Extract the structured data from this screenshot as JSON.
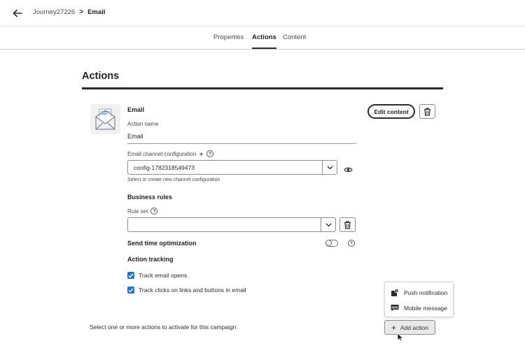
{
  "breadcrumb": {
    "parent": "Journey27226",
    "separator": ">",
    "current": "Email"
  },
  "tabs": [
    {
      "label": "Properties",
      "active": false
    },
    {
      "label": "Actions",
      "active": true
    },
    {
      "label": "Content",
      "active": false
    }
  ],
  "section": {
    "title": "Actions"
  },
  "action": {
    "heading": "Email",
    "thumb_icon": "envelope-icon",
    "edit_content_label": "Edit content",
    "action_name_label": "Action name",
    "action_name_value": "Email",
    "channel_config_label": "Email channel configuration",
    "required_mark": "∗",
    "channel_config_value": "config-1782318549473",
    "channel_config_help": "Select or create new channel configuration"
  },
  "business_rules": {
    "heading": "Business rules",
    "rule_set_label": "Rule set",
    "rule_set_value": ""
  },
  "send_time": {
    "label": "Send time optimization",
    "enabled": false
  },
  "tracking": {
    "heading": "Action tracking",
    "items": [
      {
        "label": "Track email opens",
        "checked": true
      },
      {
        "label": "Track clicks on links and buttons in email",
        "checked": true
      }
    ]
  },
  "footer": {
    "text": "Select one or more actions to activate for this campaign"
  },
  "add_menu": {
    "items": [
      {
        "label": "Push notification",
        "icon": "push-notification-icon"
      },
      {
        "label": "Mobile message",
        "icon": "sms-icon"
      }
    ],
    "button_label": "Add action",
    "plus": "+"
  },
  "colors": {
    "accent": "#1473e6",
    "text": "#2c2c2c",
    "rule": "#2c2c2c"
  }
}
